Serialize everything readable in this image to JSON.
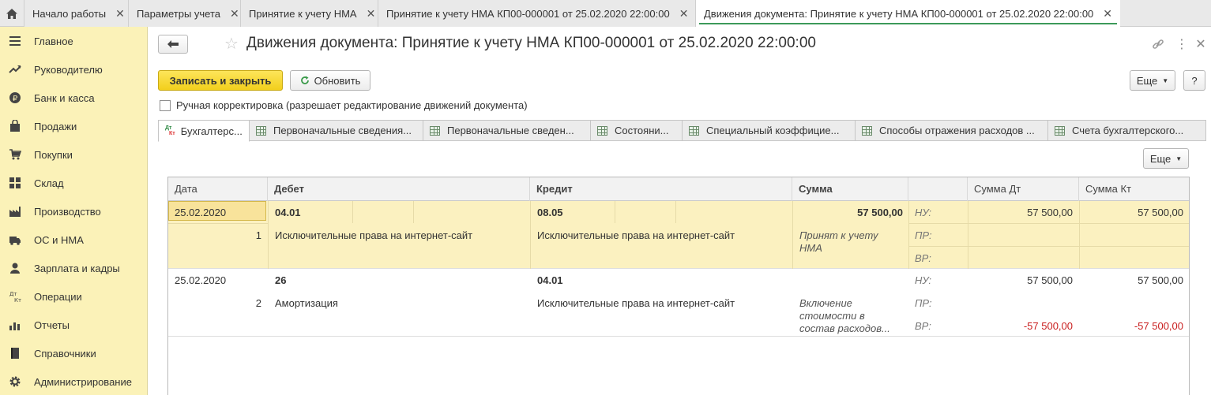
{
  "window_tabs": [
    {
      "label": "Начало работы"
    },
    {
      "label": "Параметры учета"
    },
    {
      "label": "Принятие к учету НМА"
    },
    {
      "label": "Принятие к учету НМА КП00-000001 от 25.02.2020 22:00:00"
    },
    {
      "label": "Движения документа: Принятие к учету НМА КП00-000001 от 25.02.2020 22:00:00",
      "active": true
    }
  ],
  "sidebar": {
    "items": [
      {
        "label": "Главное",
        "icon": "menu-lines-icon"
      },
      {
        "label": "Руководителю",
        "icon": "trend-icon"
      },
      {
        "label": "Банк и касса",
        "icon": "coin-icon"
      },
      {
        "label": "Продажи",
        "icon": "bag-icon"
      },
      {
        "label": "Покупки",
        "icon": "cart-icon"
      },
      {
        "label": "Склад",
        "icon": "grid-icon"
      },
      {
        "label": "Производство",
        "icon": "factory-icon"
      },
      {
        "label": "ОС и НМА",
        "icon": "truck-icon"
      },
      {
        "label": "Зарплата и кадры",
        "icon": "person-icon"
      },
      {
        "label": "Операции",
        "icon": "dt-kt-icon"
      },
      {
        "label": "Отчеты",
        "icon": "bar-chart-icon"
      },
      {
        "label": "Справочники",
        "icon": "book-icon"
      },
      {
        "label": "Администрирование",
        "icon": "gear-icon"
      }
    ]
  },
  "header": {
    "title": "Движения документа: Принятие к учету НМА КП00-000001 от 25.02.2020 22:00:00"
  },
  "toolbar": {
    "save_close": "Записать и закрыть",
    "refresh": "Обновить",
    "more": "Еще",
    "help": "?"
  },
  "manual_edit": {
    "label": "Ручная корректировка (разрешает редактирование движений документа)",
    "checked": false
  },
  "form_tabs": [
    {
      "label": "Бухгалтерс...",
      "icon": "dt-kt-icon",
      "active": true
    },
    {
      "label": "Первоначальные сведения...",
      "icon": "table-icon"
    },
    {
      "label": "Первоначальные сведен...",
      "icon": "table-icon"
    },
    {
      "label": "Состояни...",
      "icon": "table-icon"
    },
    {
      "label": "Специальный коэффицие...",
      "icon": "table-icon"
    },
    {
      "label": "Способы отражения расходов ...",
      "icon": "table-icon"
    },
    {
      "label": "Счета бухгалтерского...",
      "icon": "table-icon"
    }
  ],
  "table_more": "Еще",
  "table": {
    "columns": [
      "Дата",
      "Дебет",
      "Кредит",
      "Сумма",
      "",
      "Сумма Дт",
      "Сумма Кт"
    ],
    "rows": [
      {
        "date": "25.02.2020",
        "number": "1",
        "debit_account": "04.01",
        "debit_subconto": "Исключительные права на интернет-сайт",
        "credit_account": "08.05",
        "credit_subconto": "Исключительные права на интернет-сайт",
        "amount": "57 500,00",
        "content_line1": "Принят к учету",
        "content_line2": "НМА",
        "content_line3": "",
        "nu_label": "НУ:",
        "pr_label": "ПР:",
        "vr_label": "ВР:",
        "nu_dt": "57 500,00",
        "nu_kt": "57 500,00",
        "pr_dt": "",
        "pr_kt": "",
        "vr_dt": "",
        "vr_kt": ""
      },
      {
        "date": "25.02.2020",
        "number": "2",
        "debit_account": "26",
        "debit_subconto": "Амортизация",
        "credit_account": "04.01",
        "credit_subconto": "Исключительные права на интернет-сайт",
        "amount": "",
        "content_line1": "Включение",
        "content_line2": "стоимости в",
        "content_line3": "состав расходов...",
        "nu_label": "НУ:",
        "pr_label": "ПР:",
        "vr_label": "ВР:",
        "nu_dt": "57 500,00",
        "nu_kt": "57 500,00",
        "pr_dt": "",
        "pr_kt": "",
        "vr_dt": "-57 500,00",
        "vr_kt": "-57 500,00"
      }
    ]
  },
  "colors": {
    "sidebar_bg": "#fbf2b8",
    "selected_row": "#fbf1c0",
    "primary_button": "#f2cf1c",
    "active_tab_underline": "#3d9a5a",
    "negative": "#c91e1e"
  }
}
